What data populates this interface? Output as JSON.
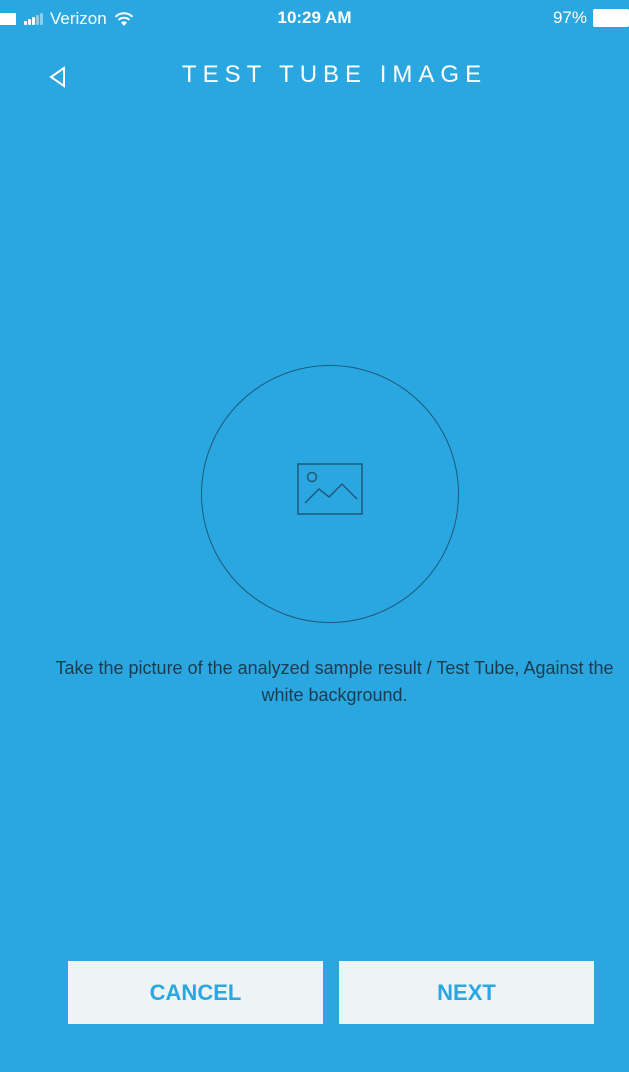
{
  "status_bar": {
    "carrier": "Verizon",
    "time": "10:29 AM",
    "battery": "97%",
    "icons": [
      "signal-icon",
      "wifi-icon",
      "battery-icon"
    ]
  },
  "nav": {
    "title": "TEST TUBE IMAGE",
    "back_icon": "back-arrow-icon"
  },
  "photo_picker": {
    "icon": "image-placeholder-icon",
    "instruction": "Take the picture of the analyzed sample result / Test Tube, Against the white background."
  },
  "actions": {
    "cancel_label": "CANCEL",
    "next_label": "NEXT"
  },
  "colors": {
    "background": "#2aa7e0",
    "button_bg": "#eef3f6",
    "button_text": "#2aa7e0",
    "instruction_text": "#1c3b4d"
  }
}
